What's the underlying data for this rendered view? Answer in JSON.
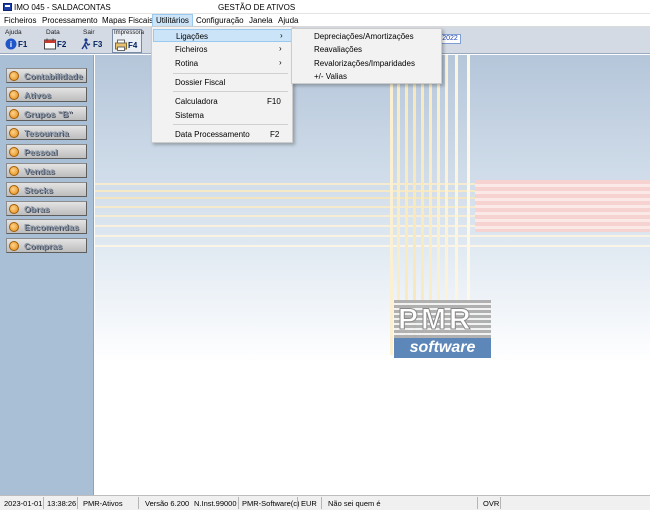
{
  "window": {
    "title": "IMO 045 - SALDACONTAS",
    "center_title": "GESTÃO DE ATIVOS"
  },
  "menubar": {
    "items": [
      "Ficheiros",
      "Processamento",
      "Mapas Fiscais",
      "Utilitários",
      "Configuração",
      "Janela",
      "Ajuda"
    ],
    "active": "Utilitários"
  },
  "toolbar": {
    "buttons": [
      {
        "caption": "Ajuda",
        "key": "F1",
        "icon": "help-icon"
      },
      {
        "caption": "Data",
        "key": "F2",
        "icon": "calendar-icon"
      },
      {
        "caption": "Sair",
        "key": "F3",
        "icon": "exit-icon"
      },
      {
        "caption": "Impressora",
        "key": "F4",
        "icon": "printer-icon"
      }
    ],
    "date_chip": "2022"
  },
  "sidebar": {
    "items": [
      "Contabilidade",
      "Ativos",
      "Grupos \"B\"",
      "Tesouraria",
      "Pessoal",
      "Vendas",
      "Stocks",
      "Obras",
      "Encomendas",
      "Compras"
    ]
  },
  "utilitarios_menu": {
    "items": [
      {
        "label": "Ligações",
        "shortcut": "",
        "submenu": true
      },
      {
        "label": "Ficheiros",
        "shortcut": "",
        "submenu": true
      },
      {
        "label": "Rotina",
        "shortcut": "",
        "submenu": true
      },
      {
        "label": "Dossier Fiscal",
        "shortcut": "",
        "submenu": false
      },
      {
        "label": "Calculadora",
        "shortcut": "F10",
        "submenu": false
      },
      {
        "label": "Sistema",
        "shortcut": "",
        "submenu": false
      },
      {
        "label": "Data Processamento",
        "shortcut": "F2",
        "submenu": false
      }
    ],
    "arrow": "›"
  },
  "ligacoes_submenu": {
    "items": [
      "Depreciações/Amortizações",
      "Reavaliações",
      "Revalorizações/Imparidades",
      "+/- Valias"
    ]
  },
  "logo": {
    "top": "PMR",
    "bottom": "software"
  },
  "statusbar": {
    "date": "2023-01-01",
    "time": "13:38:26",
    "module": "PMR-Ativos",
    "version": "Versão  6.200",
    "install": "N.Inst.99000",
    "company": "PMR-Software(c)",
    "currency": "EUR",
    "user": "Não sei quem é",
    "mode": "OVR"
  },
  "colors": {
    "toolbar_bg": "#d3dae4",
    "sidebar_bg": "#a9bfd6",
    "menu_highlight": "#cce4f7",
    "logo_blue": "#5d87b9"
  }
}
